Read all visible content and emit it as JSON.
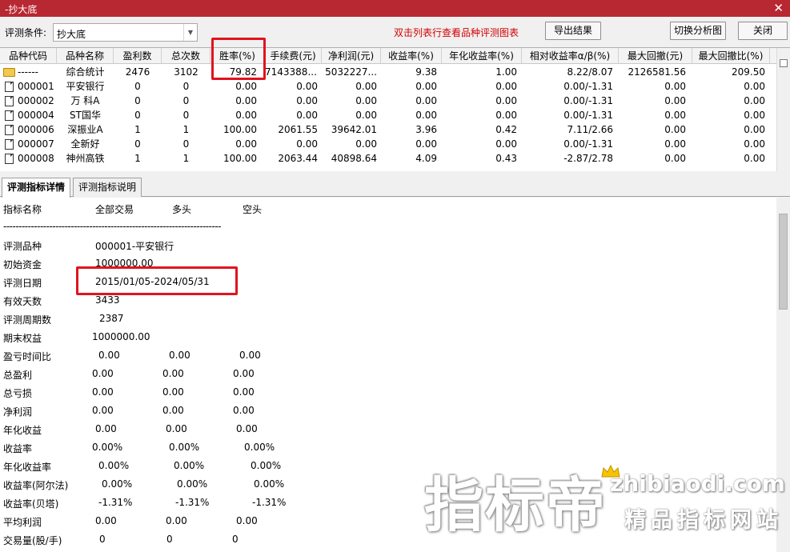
{
  "window": {
    "title": "-抄大底",
    "close_icon": "close-icon"
  },
  "toolbar": {
    "condition_label": "评测条件:",
    "condition_value": "抄大底",
    "hint": "双击列表行查看品种评测图表",
    "export_button": "导出结果",
    "switch_button": "切换分析图",
    "close_button": "关闭"
  },
  "colors": {
    "titlebar": "#b82832",
    "hint": "#d40000",
    "highlight_box": "#e0141e"
  },
  "grid": {
    "columns": [
      "品种代码",
      "品种名称",
      "盈利数",
      "总次数",
      "胜率(%)",
      "手续费(元)",
      "净利润(元)",
      "收益率(%)",
      "年化收益率(%)",
      "相对收益率α/β(%)",
      "最大回撤(元)",
      "最大回撤比(%)"
    ],
    "rows": [
      {
        "icon": "folder-icon",
        "cells": [
          "------",
          "综合统计",
          "2476",
          "3102",
          "79.82",
          "7143388....",
          "5032227...",
          "9.38",
          "1.00",
          "8.22/8.07",
          "2126581.56",
          "209.50"
        ]
      },
      {
        "icon": "document-icon",
        "cells": [
          "000001",
          "平安银行",
          "0",
          "0",
          "0.00",
          "0.00",
          "0.00",
          "0.00",
          "0.00",
          "0.00/-1.31",
          "0.00",
          "0.00"
        ]
      },
      {
        "icon": "document-icon",
        "cells": [
          "000002",
          "万 科A",
          "0",
          "0",
          "0.00",
          "0.00",
          "0.00",
          "0.00",
          "0.00",
          "0.00/-1.31",
          "0.00",
          "0.00"
        ]
      },
      {
        "icon": "document-icon",
        "cells": [
          "000004",
          "ST国华",
          "0",
          "0",
          "0.00",
          "0.00",
          "0.00",
          "0.00",
          "0.00",
          "0.00/-1.31",
          "0.00",
          "0.00"
        ]
      },
      {
        "icon": "document-icon",
        "cells": [
          "000006",
          "深振业A",
          "1",
          "1",
          "100.00",
          "2061.55",
          "39642.01",
          "3.96",
          "0.42",
          "7.11/2.66",
          "0.00",
          "0.00"
        ]
      },
      {
        "icon": "document-icon",
        "cells": [
          "000007",
          "全新好",
          "0",
          "0",
          "0.00",
          "0.00",
          "0.00",
          "0.00",
          "0.00",
          "0.00/-1.31",
          "0.00",
          "0.00"
        ]
      },
      {
        "icon": "document-icon",
        "cells": [
          "000008",
          "神州高铁",
          "1",
          "1",
          "100.00",
          "2063.44",
          "40898.64",
          "4.09",
          "0.43",
          "-2.87/2.78",
          "0.00",
          "0.00"
        ]
      }
    ]
  },
  "tabs": [
    "评测指标详情",
    "评测指标说明"
  ],
  "detail": {
    "header": [
      "指标名称",
      "全部交易",
      "多头",
      "空头"
    ],
    "separator": "-----------------------------------------------------------------------",
    "info": [
      {
        "label": "评测品种",
        "value": "000001-平安银行"
      },
      {
        "label": "初始资金",
        "value": "1000000.00"
      },
      {
        "label": "评测日期",
        "value": "2015/01/05-2024/05/31"
      },
      {
        "label": "有效天数",
        "value": "3433"
      },
      {
        "label": "评测周期数",
        "value": "2387"
      },
      {
        "label": "期末权益",
        "value": "1000000.00"
      }
    ],
    "metrics": [
      {
        "label": "盈亏时间比",
        "all": "0.00",
        "long": "0.00",
        "short": "0.00"
      },
      {
        "label": "总盈利",
        "all": "0.00",
        "long": "0.00",
        "short": "0.00"
      },
      {
        "label": "总亏损",
        "all": "0.00",
        "long": "0.00",
        "short": "0.00"
      },
      {
        "label": "净利润",
        "all": "0.00",
        "long": "0.00",
        "short": "0.00"
      },
      {
        "label": "年化收益",
        "all": "0.00",
        "long": "0.00",
        "short": "0.00"
      },
      {
        "label": "收益率",
        "all": "0.00%",
        "long": "0.00%",
        "short": "0.00%"
      },
      {
        "label": "年化收益率",
        "all": "0.00%",
        "long": "0.00%",
        "short": "0.00%"
      },
      {
        "label": "收益率(阿尔法)",
        "all": "0.00%",
        "long": "0.00%",
        "short": "0.00%"
      },
      {
        "label": "收益率(贝塔)",
        "all": "-1.31%",
        "long": "-1.31%",
        "short": "-1.31%"
      },
      {
        "label": "平均利润",
        "all": "0.00",
        "long": "0.00",
        "short": "0.00"
      },
      {
        "label": "交易量(股/手)",
        "all": "0",
        "long": "0",
        "short": "0"
      }
    ]
  },
  "watermark": {
    "brand": "指标帝",
    "url": "zhibiaodi.com",
    "slogan": "精品指标网站"
  }
}
